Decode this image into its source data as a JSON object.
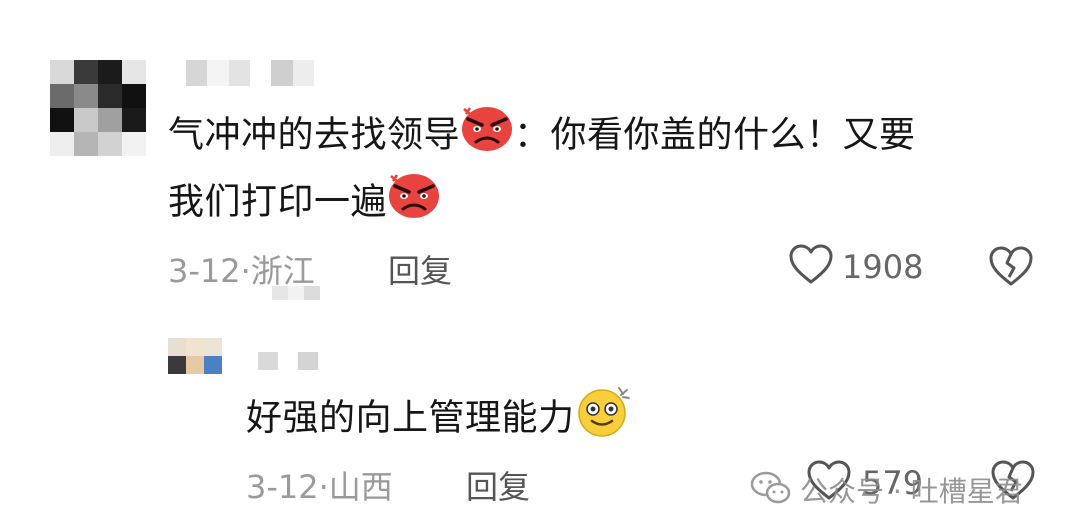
{
  "main_comment": {
    "line1": "气冲冲的去找领导",
    "line1_after": "：你看你盖的什么！又要",
    "line2": "我们打印一遍",
    "emoji": "angry-face-icon",
    "date_location": "3-12·浙江",
    "reply_label": "回复",
    "like_count": "1908"
  },
  "reply_comment": {
    "text": "好强的向上管理能力",
    "emoji": "dizzy-smile-face-icon",
    "date_location": "3-12·山西",
    "reply_label": "回复",
    "like_count": "579"
  },
  "watermark": {
    "text": "公众号 · 吐槽星君",
    "icon": "wechat-icon"
  },
  "colors": {
    "text": "#161616",
    "meta": "#9a9a9a",
    "angry_red": "#e8433e"
  }
}
